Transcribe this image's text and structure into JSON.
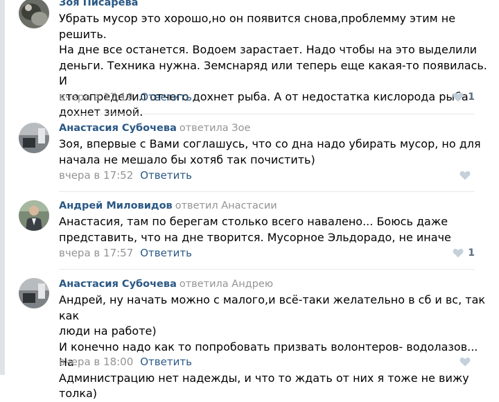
{
  "comments": [
    {
      "author": "Зоя Писарева",
      "reply_to": "",
      "text": "Убрать мусор это хорошо,но он появится снова,проблемму этим не решить.\nНа дне все останется. Водоем зарастает. Надо чтобы на это выделили\nденьги. Техника нужна. Земснаряд или теперь еще какая-то появилась. И\nкто определил отчего дохнет рыба. А от недостатка кислорода рыба\nдохнет зимой.",
      "date": "вчера в 17:19",
      "reply_label": "Ответить",
      "likes": "1",
      "avatar": "blurred-photo"
    },
    {
      "author": "Анастасия Субочева",
      "reply_to": "ответила Зое",
      "text": "Зоя, впервые с Вами соглашусь, что со дна надо убирать мусор, но для\nначала не мешало бы хотяб так почистить)",
      "date": "вчера в 17:52",
      "reply_label": "Ответить",
      "likes": "",
      "avatar": "car-photo"
    },
    {
      "author": "Андрей Миловидов",
      "reply_to": "ответил Анастасии",
      "text": "Анастасия, там по берегам столько всего навалено... Боюсь даже\nпредставить, что на дне творится. Мусорное Эльдорадо, не иначе",
      "date": "вчера в 17:57",
      "reply_label": "Ответить",
      "likes": "1",
      "avatar": "man-photo"
    },
    {
      "author": "Анастасия Субочева",
      "reply_to": "ответила Андрею",
      "text": "Андрей, ну начать можно с малого,и всё-таки желательно в сб и вс, так как\nлюди на работе)\nИ конечно надо как то попробовать призвать волонтеров- водолазов... На\nАдминистрацию нет надежды, и что то ждать от них я тоже не вижу толка)",
      "date": "вчера в 18:00",
      "reply_label": "Ответить",
      "likes": "",
      "avatar": "car-photo"
    }
  ],
  "colors": {
    "link": "#2a5885",
    "muted": "#939393",
    "divider": "#e7e8ec",
    "like_icon": "#c5d0db"
  },
  "icons": {
    "like": "heart-icon"
  }
}
